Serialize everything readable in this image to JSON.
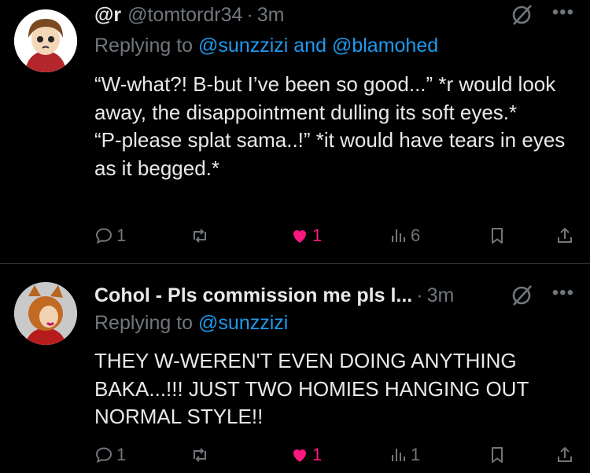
{
  "tweets": [
    {
      "name": "@r",
      "handle": "@tomtordr34",
      "dot": "·",
      "time": "3m",
      "replying_prefix": "Replying to",
      "replying_mention1": "@sunzzizi",
      "replying_and": "and",
      "replying_mention2": "@blamohed",
      "lines": [
        "“W-what?! B-but I’ve been so good...” *r would look away, the disappointment dulling its soft eyes.*",
        "“P-please splat sama..!” *it would have tears in eyes as it begged.*"
      ],
      "replies": "1",
      "retweets": "",
      "likes": "1",
      "views": "6"
    },
    {
      "name": "Cohol - Pls commission me pls l...",
      "dot": "·",
      "time": "3m",
      "replying_prefix": "Replying to",
      "replying_mention1": "@sunzzizi",
      "lines": [
        "THEY W-WEREN'T EVEN DOING ANYTHING BAKA...!!! JUST TWO HOMIES HANGING OUT NORMAL STYLE!!"
      ],
      "replies": "1",
      "retweets": "",
      "likes": "1",
      "views": "1"
    }
  ],
  "icons": {
    "more": "more-icon",
    "grok": "grok-icon",
    "reply": "reply-icon",
    "retweet": "retweet-icon",
    "like": "heart-filled-icon",
    "views": "views-icon",
    "bookmark": "bookmark-icon",
    "share": "share-icon"
  },
  "colors": {
    "background": "#000000",
    "text": "#e7e9ea",
    "muted": "#71767b",
    "link": "#1d9bf0",
    "like": "#f91880",
    "divider": "#2f3336"
  }
}
